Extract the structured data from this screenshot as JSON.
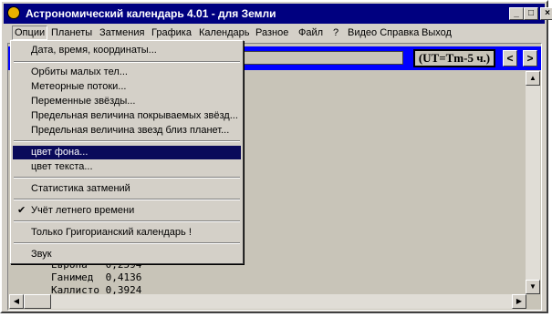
{
  "window": {
    "title": "Астрономический календарь 4.01  - для Земли",
    "buttons": {
      "minimize": "_",
      "maximize": "□",
      "close": "×"
    }
  },
  "menubar": {
    "items": [
      {
        "label": "Опции"
      },
      {
        "label": "Планеты"
      },
      {
        "label": "Затмения"
      },
      {
        "label": "Графика"
      },
      {
        "label": "Календарь"
      },
      {
        "label": "Разное"
      },
      {
        "label": "Файл"
      },
      {
        "label": "?"
      },
      {
        "label": "Видео Справка"
      },
      {
        "label": "Выход"
      }
    ]
  },
  "toolbar": {
    "timezone": "(UT=Tm-5 ч.)",
    "prev": "<",
    "next": ">"
  },
  "dropdown": {
    "items": [
      {
        "label": "Дата, время, координаты..."
      },
      {
        "label": "Орбиты малых тел..."
      },
      {
        "label": "Метеорные потоки..."
      },
      {
        "label": "Переменные звёзды..."
      },
      {
        "label": "Предельная величина покрываемых звёзд..."
      },
      {
        "label": "Предельная величина звезд близ планет..."
      },
      {
        "label": "цвет фона..."
      },
      {
        "label": "цвет текста..."
      },
      {
        "label": "Статистика затмений"
      },
      {
        "label": "Учёт летнего времени",
        "checked": "✔"
      },
      {
        "label": "Только Григорианский календарь !"
      },
      {
        "label": "Звук"
      }
    ]
  },
  "content": {
    "lines": [
      "Европа   0,2594",
      "Ганимед  0,4136",
      "Каллисто 0,3924"
    ]
  }
}
